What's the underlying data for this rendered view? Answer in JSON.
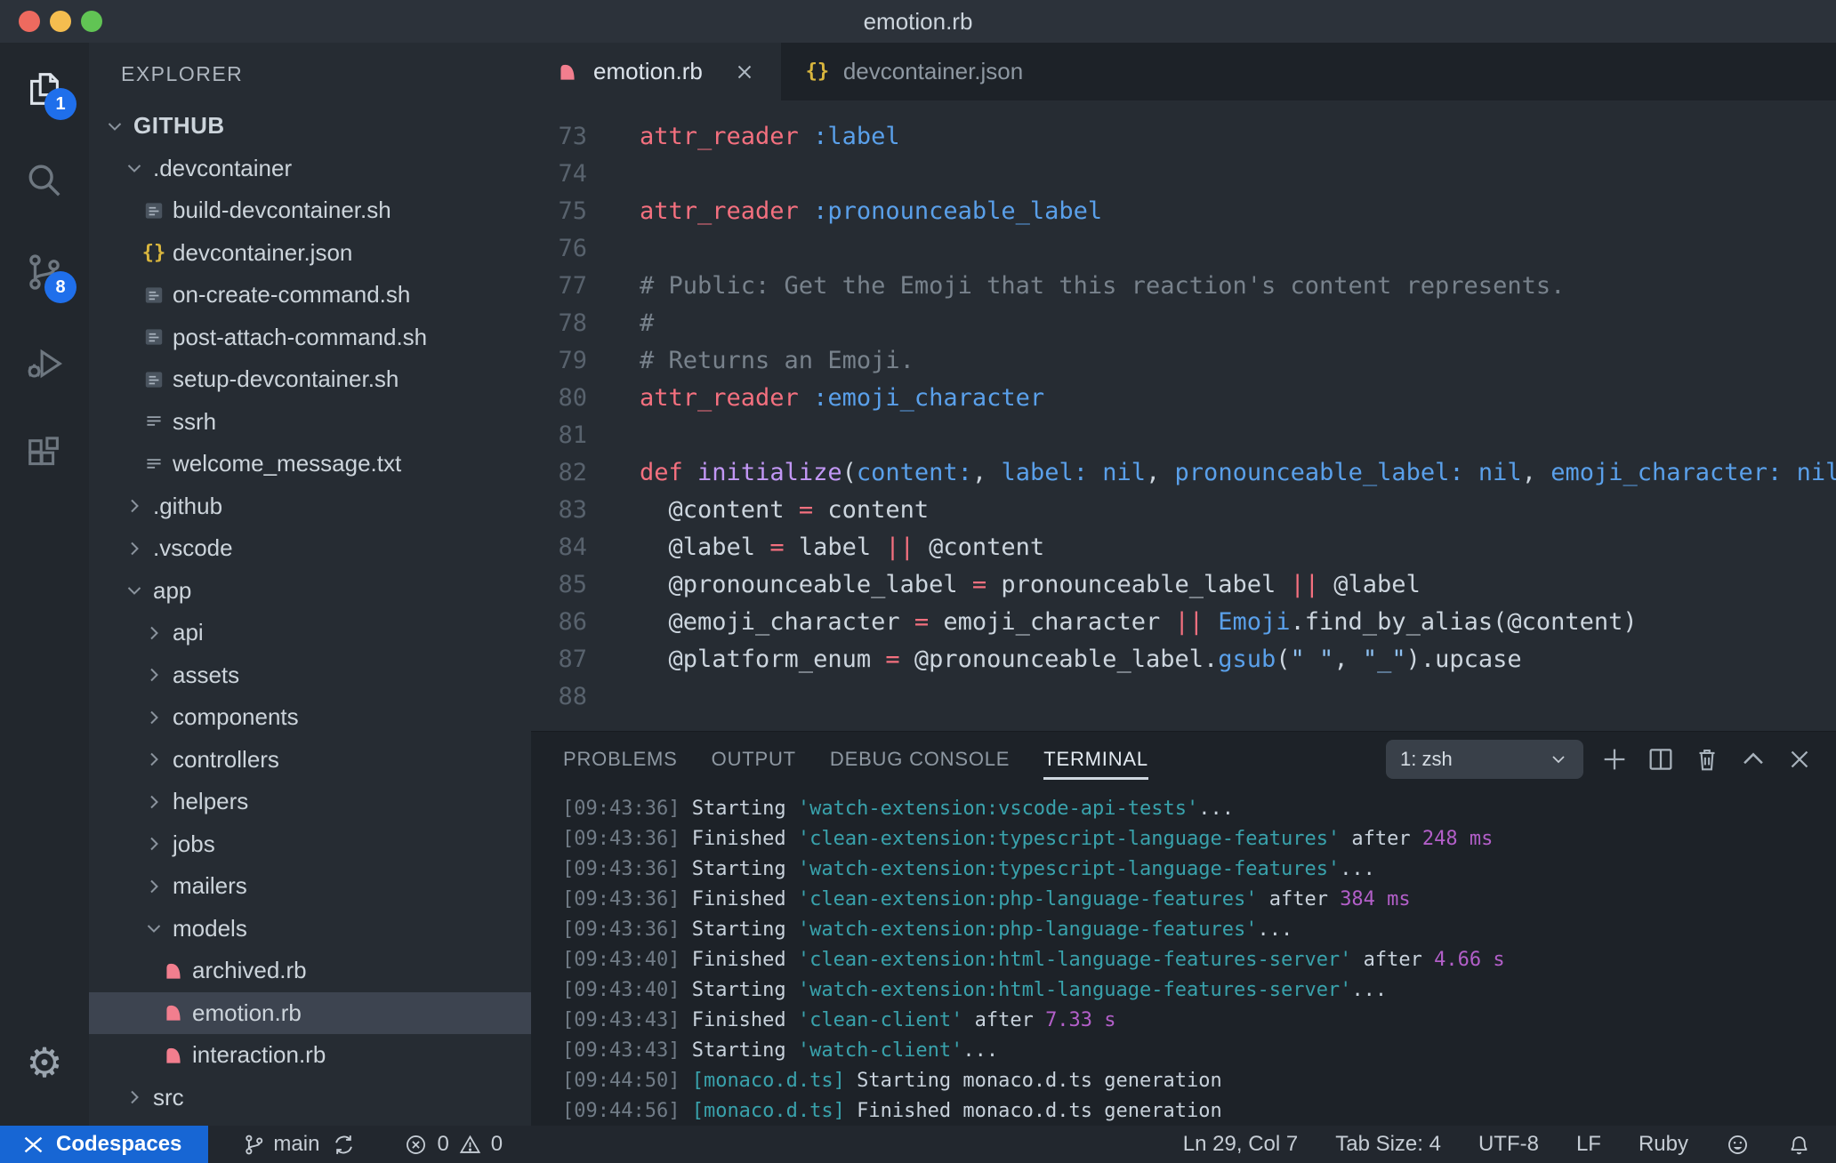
{
  "window": {
    "title": "emotion.rb"
  },
  "colors": {
    "badge_blue": "#1f6feb",
    "codespaces_blue": "#1766d4",
    "ruby_pink": "#f27e8e",
    "json_yellow": "#d9b63e",
    "keyword_pink": "#f4707f",
    "symbol_blue": "#5aa0ea",
    "terminal_cyan": "#39a2ac",
    "terminal_magenta": "#b35fc9"
  },
  "activity_bar": {
    "explorer_badge": "1",
    "scm_badge": "8"
  },
  "sidebar": {
    "title": "EXPLORER",
    "items": [
      {
        "label": "GITHUB",
        "depth": 0,
        "type": "root"
      },
      {
        "label": ".devcontainer",
        "depth": 1,
        "type": "folder-open"
      },
      {
        "label": "build-devcontainer.sh",
        "depth": 2,
        "type": "file",
        "icon": "shell"
      },
      {
        "label": "devcontainer.json",
        "depth": 2,
        "type": "file",
        "icon": "json"
      },
      {
        "label": "on-create-command.sh",
        "depth": 2,
        "type": "file",
        "icon": "shell"
      },
      {
        "label": "post-attach-command.sh",
        "depth": 2,
        "type": "file",
        "icon": "shell"
      },
      {
        "label": "setup-devcontainer.sh",
        "depth": 2,
        "type": "file",
        "icon": "shell"
      },
      {
        "label": "ssrh",
        "depth": 2,
        "type": "file",
        "icon": "text"
      },
      {
        "label": "welcome_message.txt",
        "depth": 2,
        "type": "file",
        "icon": "text"
      },
      {
        "label": ".github",
        "depth": 1,
        "type": "folder-closed"
      },
      {
        "label": ".vscode",
        "depth": 1,
        "type": "folder-closed"
      },
      {
        "label": "app",
        "depth": 1,
        "type": "folder-open"
      },
      {
        "label": "api",
        "depth": 2,
        "type": "folder-closed"
      },
      {
        "label": "assets",
        "depth": 2,
        "type": "folder-closed"
      },
      {
        "label": "components",
        "depth": 2,
        "type": "folder-closed"
      },
      {
        "label": "controllers",
        "depth": 2,
        "type": "folder-closed"
      },
      {
        "label": "helpers",
        "depth": 2,
        "type": "folder-closed"
      },
      {
        "label": "jobs",
        "depth": 2,
        "type": "folder-closed"
      },
      {
        "label": "mailers",
        "depth": 2,
        "type": "folder-closed"
      },
      {
        "label": "models",
        "depth": 2,
        "type": "folder-open"
      },
      {
        "label": "archived.rb",
        "depth": 3,
        "type": "file",
        "icon": "ruby"
      },
      {
        "label": "emotion.rb",
        "depth": 3,
        "type": "file",
        "icon": "ruby",
        "selected": true
      },
      {
        "label": "interaction.rb",
        "depth": 3,
        "type": "file",
        "icon": "ruby"
      },
      {
        "label": "src",
        "depth": 1,
        "type": "folder-closed"
      }
    ]
  },
  "tabs": [
    {
      "label": "emotion.rb",
      "icon": "ruby",
      "active": true
    },
    {
      "label": "devcontainer.json",
      "icon": "json",
      "active": false
    }
  ],
  "editor": {
    "lines": [
      {
        "num": "73",
        "tokens": [
          {
            "c": "kw",
            "t": "attr_reader"
          },
          {
            "c": "pln",
            "t": " "
          },
          {
            "c": "sym",
            "t": ":label"
          }
        ]
      },
      {
        "num": "74",
        "tokens": []
      },
      {
        "num": "75",
        "tokens": [
          {
            "c": "kw",
            "t": "attr_reader"
          },
          {
            "c": "pln",
            "t": " "
          },
          {
            "c": "sym",
            "t": ":pronounceable_label"
          }
        ]
      },
      {
        "num": "76",
        "tokens": []
      },
      {
        "num": "77",
        "tokens": [
          {
            "c": "cmt",
            "t": "# Public: Get the Emoji that this reaction's content represents."
          }
        ]
      },
      {
        "num": "78",
        "tokens": [
          {
            "c": "cmt",
            "t": "#"
          }
        ]
      },
      {
        "num": "79",
        "tokens": [
          {
            "c": "cmt",
            "t": "# Returns an Emoji."
          }
        ]
      },
      {
        "num": "80",
        "tokens": [
          {
            "c": "kw",
            "t": "attr_reader"
          },
          {
            "c": "pln",
            "t": " "
          },
          {
            "c": "sym",
            "t": ":emoji_character"
          }
        ]
      },
      {
        "num": "81",
        "tokens": []
      },
      {
        "num": "82",
        "tokens": [
          {
            "c": "kw",
            "t": "def"
          },
          {
            "c": "pln",
            "t": " "
          },
          {
            "c": "fn",
            "t": "initialize"
          },
          {
            "c": "pln",
            "t": "("
          },
          {
            "c": "sym",
            "t": "content:"
          },
          {
            "c": "pln",
            "t": ", "
          },
          {
            "c": "sym",
            "t": "label:"
          },
          {
            "c": "pln",
            "t": " "
          },
          {
            "c": "sym",
            "t": "nil"
          },
          {
            "c": "pln",
            "t": ", "
          },
          {
            "c": "sym",
            "t": "pronounceable_label:"
          },
          {
            "c": "pln",
            "t": " "
          },
          {
            "c": "sym",
            "t": "nil"
          },
          {
            "c": "pln",
            "t": ", "
          },
          {
            "c": "sym",
            "t": "emoji_character:"
          },
          {
            "c": "pln",
            "t": " "
          },
          {
            "c": "sym",
            "t": "nil"
          },
          {
            "c": "pln",
            "t": ")"
          }
        ]
      },
      {
        "num": "83",
        "tokens": [
          {
            "c": "pln",
            "t": "  @content "
          },
          {
            "c": "kw",
            "t": "="
          },
          {
            "c": "pln",
            "t": " content"
          }
        ]
      },
      {
        "num": "84",
        "tokens": [
          {
            "c": "pln",
            "t": "  @label "
          },
          {
            "c": "kw",
            "t": "="
          },
          {
            "c": "pln",
            "t": " label "
          },
          {
            "c": "kw",
            "t": "||"
          },
          {
            "c": "pln",
            "t": " @content"
          }
        ]
      },
      {
        "num": "85",
        "tokens": [
          {
            "c": "pln",
            "t": "  @pronounceable_label "
          },
          {
            "c": "kw",
            "t": "="
          },
          {
            "c": "pln",
            "t": " pronounceable_label "
          },
          {
            "c": "kw",
            "t": "||"
          },
          {
            "c": "pln",
            "t": " @label"
          }
        ]
      },
      {
        "num": "86",
        "tokens": [
          {
            "c": "pln",
            "t": "  @emoji_character "
          },
          {
            "c": "kw",
            "t": "="
          },
          {
            "c": "pln",
            "t": " emoji_character "
          },
          {
            "c": "kw",
            "t": "||"
          },
          {
            "c": "pln",
            "t": " "
          },
          {
            "c": "sym",
            "t": "Emoji"
          },
          {
            "c": "pln",
            "t": ".find_by_alias(@content)"
          }
        ]
      },
      {
        "num": "87",
        "tokens": [
          {
            "c": "pln",
            "t": "  @platform_enum "
          },
          {
            "c": "kw",
            "t": "="
          },
          {
            "c": "pln",
            "t": " @pronounceable_label."
          },
          {
            "c": "sym",
            "t": "gsub"
          },
          {
            "c": "pln",
            "t": "("
          },
          {
            "c": "str",
            "t": "\" \""
          },
          {
            "c": "pln",
            "t": ", "
          },
          {
            "c": "str",
            "t": "\"_\""
          },
          {
            "c": "pln",
            "t": ").upcase"
          }
        ]
      },
      {
        "num": "88",
        "tokens": []
      }
    ]
  },
  "panel": {
    "tabs": [
      "PROBLEMS",
      "OUTPUT",
      "DEBUG CONSOLE",
      "TERMINAL"
    ],
    "active_tab": "TERMINAL",
    "shell_select": "1: zsh",
    "terminal_lines": [
      [
        {
          "c": "ts",
          "t": "[09:43:36]"
        },
        {
          "c": "txt",
          "t": " Starting "
        },
        {
          "c": "cyan",
          "t": "'watch-extension:vscode-api-tests'"
        },
        {
          "c": "txt",
          "t": "..."
        }
      ],
      [
        {
          "c": "ts",
          "t": "[09:43:36]"
        },
        {
          "c": "txt",
          "t": " Finished "
        },
        {
          "c": "cyan",
          "t": "'clean-extension:typescript-language-features'"
        },
        {
          "c": "txt",
          "t": " after "
        },
        {
          "c": "mag",
          "t": "248 ms"
        }
      ],
      [
        {
          "c": "ts",
          "t": "[09:43:36]"
        },
        {
          "c": "txt",
          "t": " Starting "
        },
        {
          "c": "cyan",
          "t": "'watch-extension:typescript-language-features'"
        },
        {
          "c": "txt",
          "t": "..."
        }
      ],
      [
        {
          "c": "ts",
          "t": "[09:43:36]"
        },
        {
          "c": "txt",
          "t": " Finished "
        },
        {
          "c": "cyan",
          "t": "'clean-extension:php-language-features'"
        },
        {
          "c": "txt",
          "t": " after "
        },
        {
          "c": "mag",
          "t": "384 ms"
        }
      ],
      [
        {
          "c": "ts",
          "t": "[09:43:36]"
        },
        {
          "c": "txt",
          "t": " Starting "
        },
        {
          "c": "cyan",
          "t": "'watch-extension:php-language-features'"
        },
        {
          "c": "txt",
          "t": "..."
        }
      ],
      [
        {
          "c": "ts",
          "t": "[09:43:40]"
        },
        {
          "c": "txt",
          "t": " Finished "
        },
        {
          "c": "cyan",
          "t": "'clean-extension:html-language-features-server'"
        },
        {
          "c": "txt",
          "t": " after "
        },
        {
          "c": "mag",
          "t": "4.66 s"
        }
      ],
      [
        {
          "c": "ts",
          "t": "[09:43:40]"
        },
        {
          "c": "txt",
          "t": " Starting "
        },
        {
          "c": "cyan",
          "t": "'watch-extension:html-language-features-server'"
        },
        {
          "c": "txt",
          "t": "..."
        }
      ],
      [
        {
          "c": "ts",
          "t": "[09:43:43]"
        },
        {
          "c": "txt",
          "t": " Finished "
        },
        {
          "c": "cyan",
          "t": "'clean-client'"
        },
        {
          "c": "txt",
          "t": " after "
        },
        {
          "c": "mag",
          "t": "7.33 s"
        }
      ],
      [
        {
          "c": "ts",
          "t": "[09:43:43]"
        },
        {
          "c": "txt",
          "t": " Starting "
        },
        {
          "c": "cyan",
          "t": "'watch-client'"
        },
        {
          "c": "txt",
          "t": "..."
        }
      ],
      [
        {
          "c": "ts",
          "t": "[09:44:50]"
        },
        {
          "c": "txt",
          "t": " "
        },
        {
          "c": "cyan",
          "t": "[monaco.d.ts]"
        },
        {
          "c": "txt",
          "t": " Starting monaco.d.ts generation"
        }
      ],
      [
        {
          "c": "ts",
          "t": "[09:44:56]"
        },
        {
          "c": "txt",
          "t": " "
        },
        {
          "c": "cyan",
          "t": "[monaco.d.ts]"
        },
        {
          "c": "txt",
          "t": " Finished monaco.d.ts generation"
        }
      ]
    ]
  },
  "status_bar": {
    "codespaces_label": "Codespaces",
    "branch": "main",
    "errors": "0",
    "warnings": "0",
    "line_col": "Ln 29, Col 7",
    "tab_size": "Tab Size: 4",
    "encoding": "UTF-8",
    "eol": "LF",
    "language": "Ruby"
  }
}
